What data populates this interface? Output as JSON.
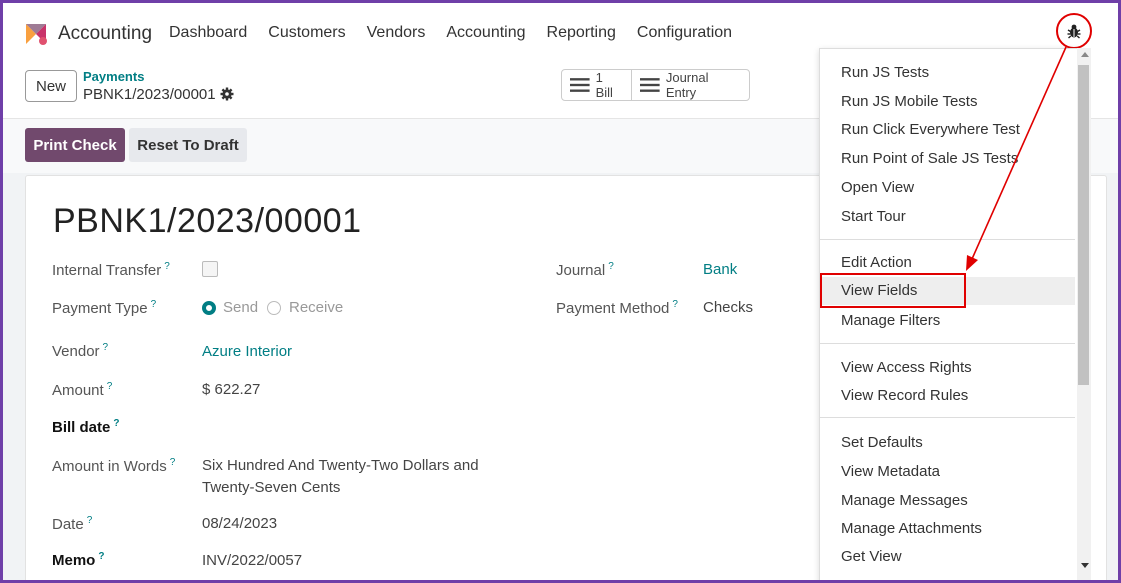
{
  "topbar": {
    "app_name": "Accounting",
    "menu": [
      "Dashboard",
      "Customers",
      "Vendors",
      "Accounting",
      "Reporting",
      "Configuration"
    ]
  },
  "control": {
    "new_label": "New",
    "breadcrumb_parent": "Payments",
    "breadcrumb_current": "PBNK1/2023/00001",
    "smart_buttons": {
      "bill": "1 Bill",
      "journal_entry": "Journal Entry"
    }
  },
  "statusbar": {
    "print_check": "Print Check",
    "reset_to_draft": "Reset To Draft"
  },
  "form": {
    "title": "PBNK1/2023/00001",
    "internal_transfer_label": "Internal Transfer",
    "payment_type_label": "Payment Type",
    "payment_type_send": "Send",
    "payment_type_receive": "Receive",
    "vendor_label": "Vendor",
    "vendor_value": "Azure Interior",
    "amount_label": "Amount",
    "amount_value": "$ 622.27",
    "bill_date_label": "Bill date",
    "amount_words_label": "Amount in Words",
    "amount_words_line1": "Six Hundred And Twenty-Two Dollars and",
    "amount_words_line2": "Twenty-Seven Cents",
    "date_label": "Date",
    "date_value": "08/24/2023",
    "memo_label": "Memo",
    "memo_value": "INV/2022/0057",
    "journal_label": "Journal",
    "journal_value": "Bank",
    "payment_method_label": "Payment Method",
    "payment_method_value": "Checks",
    "help_marker": "?"
  },
  "debug_menu": {
    "group1": [
      "Run JS Tests",
      "Run JS Mobile Tests",
      "Run Click Everywhere Test",
      "Run Point of Sale JS Tests",
      "Open View",
      "Start Tour"
    ],
    "group2": [
      "Edit Action",
      "View Fields",
      "Manage Filters"
    ],
    "group3": [
      "View Access Rights",
      "View Record Rules"
    ],
    "group4": [
      "Set Defaults",
      "View Metadata",
      "Manage Messages",
      "Manage Attachments",
      "Get View"
    ]
  },
  "colors": {
    "frame": "#6f3fa8",
    "primary": "#71496d",
    "link": "#017e84",
    "annotation": "#e00000"
  }
}
